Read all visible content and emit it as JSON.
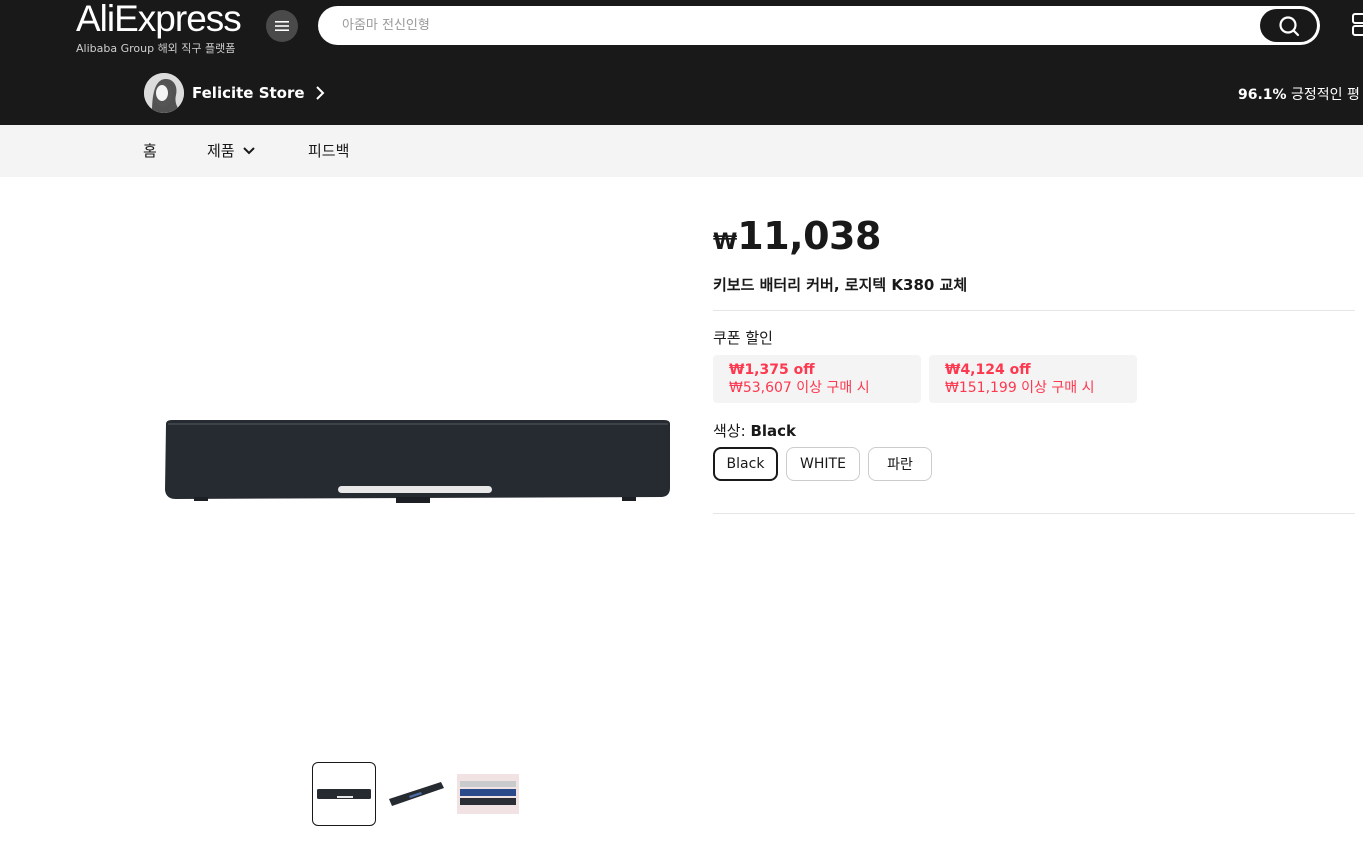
{
  "header": {
    "logo": "AliExpress",
    "logo_sub": "Alibaba Group 해외 직구 플랫폼",
    "search_placeholder": "아줌마 전신인형",
    "store_name": "Felicite Store",
    "rating_percent": "96.1%",
    "rating_text": "긍정적인 평"
  },
  "nav": {
    "home": "홈",
    "products": "제품",
    "feedback": "피드백"
  },
  "product": {
    "currency": "₩",
    "price": "11,038",
    "title": "키보드 배터리 커버, 로지텍 K380 교체",
    "coupon_label": "쿠폰 할인",
    "coupons": [
      {
        "off": "₩1,375 off",
        "condition": "₩53,607 이상 구매 시"
      },
      {
        "off": "₩4,124 off",
        "condition": "₩151,199 이상 구매 시"
      }
    ],
    "color_label": "색상: ",
    "color_selected": "Black",
    "color_options": [
      "Black",
      "WHITE",
      "파란"
    ]
  },
  "colors": {
    "header_bg": "#191919",
    "nav_bg": "#f4f4f4",
    "accent_red": "#fd384f"
  },
  "icons": [
    "menu-icon",
    "search-icon",
    "chevron-right-icon",
    "chevron-down-icon"
  ]
}
